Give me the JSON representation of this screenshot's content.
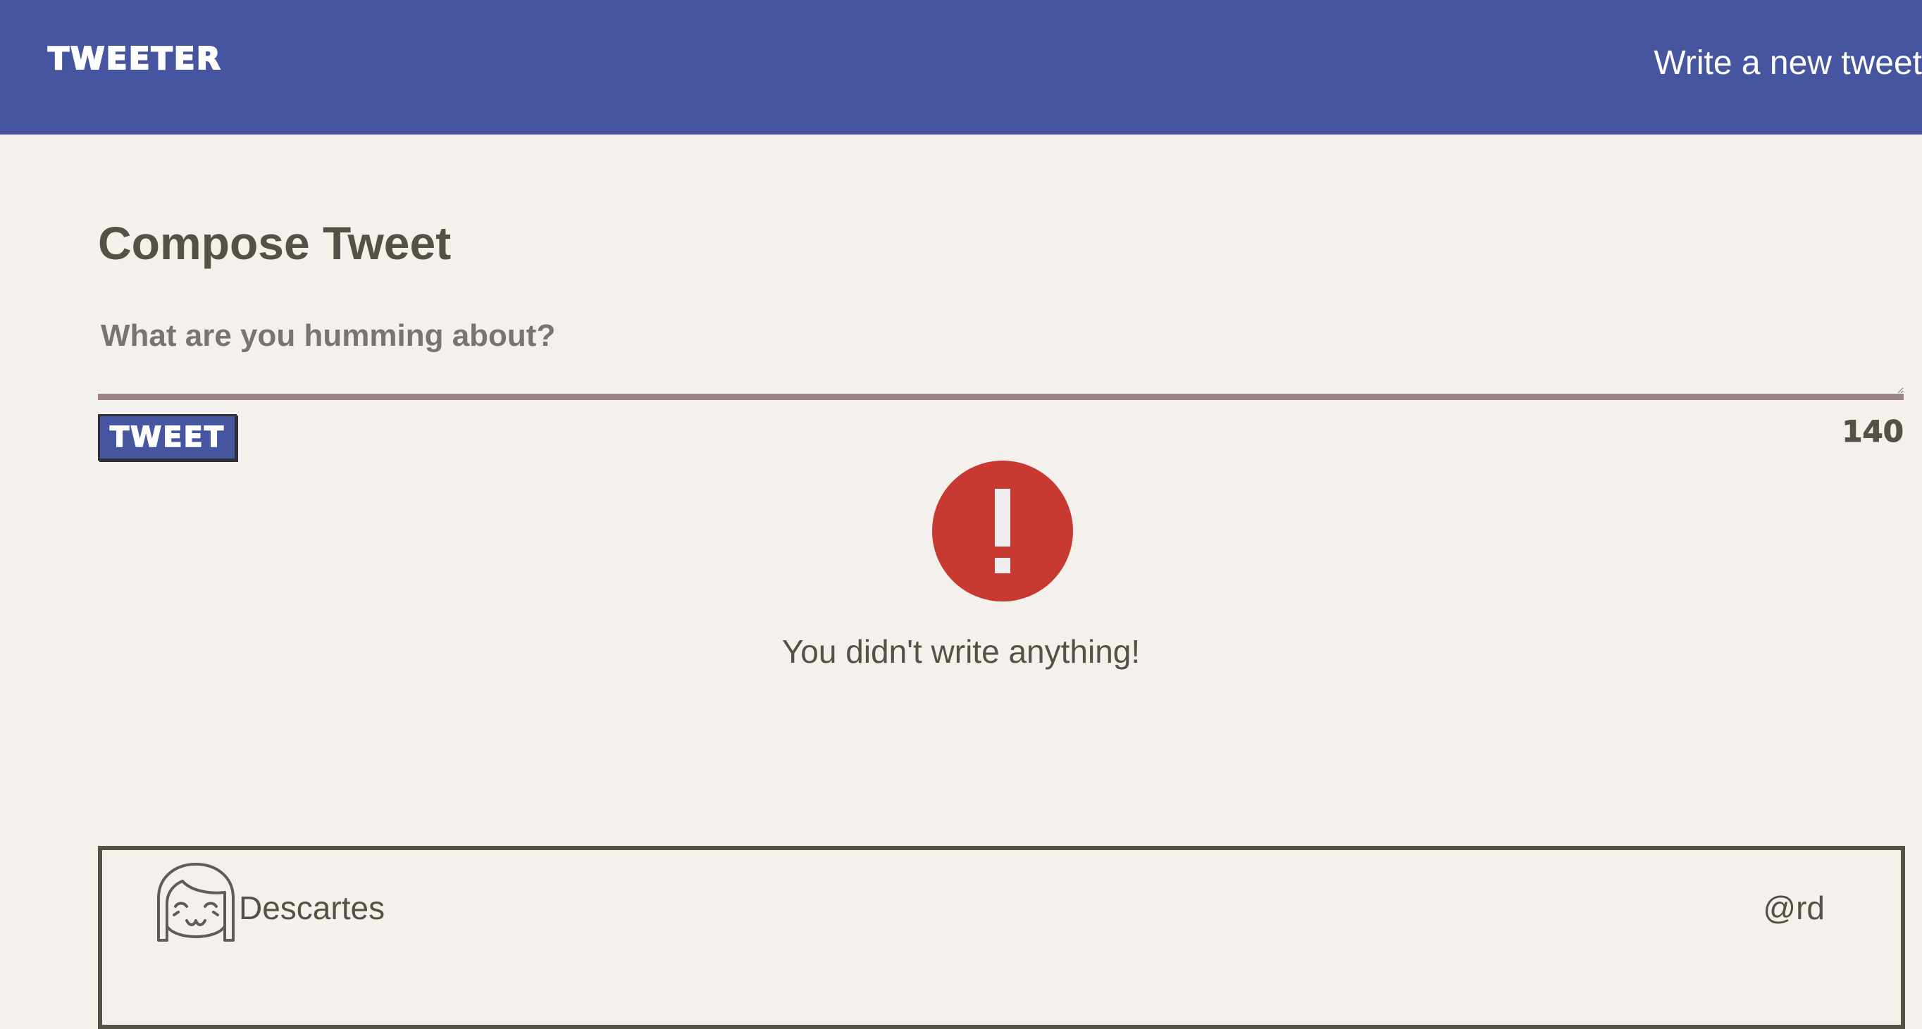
{
  "nav": {
    "brand": "TWEETER",
    "compose_link": "Write a new tweet"
  },
  "compose": {
    "title": "Compose Tweet",
    "placeholder": "What are you humming about?",
    "value": "",
    "button_label": "TWEET",
    "counter": "140"
  },
  "error": {
    "icon": "exclamation-icon",
    "message": "You didn't write anything!"
  },
  "tweets": [
    {
      "avatar_icon": "avatar-face-icon",
      "name": "Descartes",
      "handle": "@rd"
    }
  ],
  "colors": {
    "nav_bg": "#4555a0",
    "page_bg": "#f4f1ec",
    "text": "#545149",
    "error": "#c83a31",
    "textarea_border": "#9c848b"
  }
}
